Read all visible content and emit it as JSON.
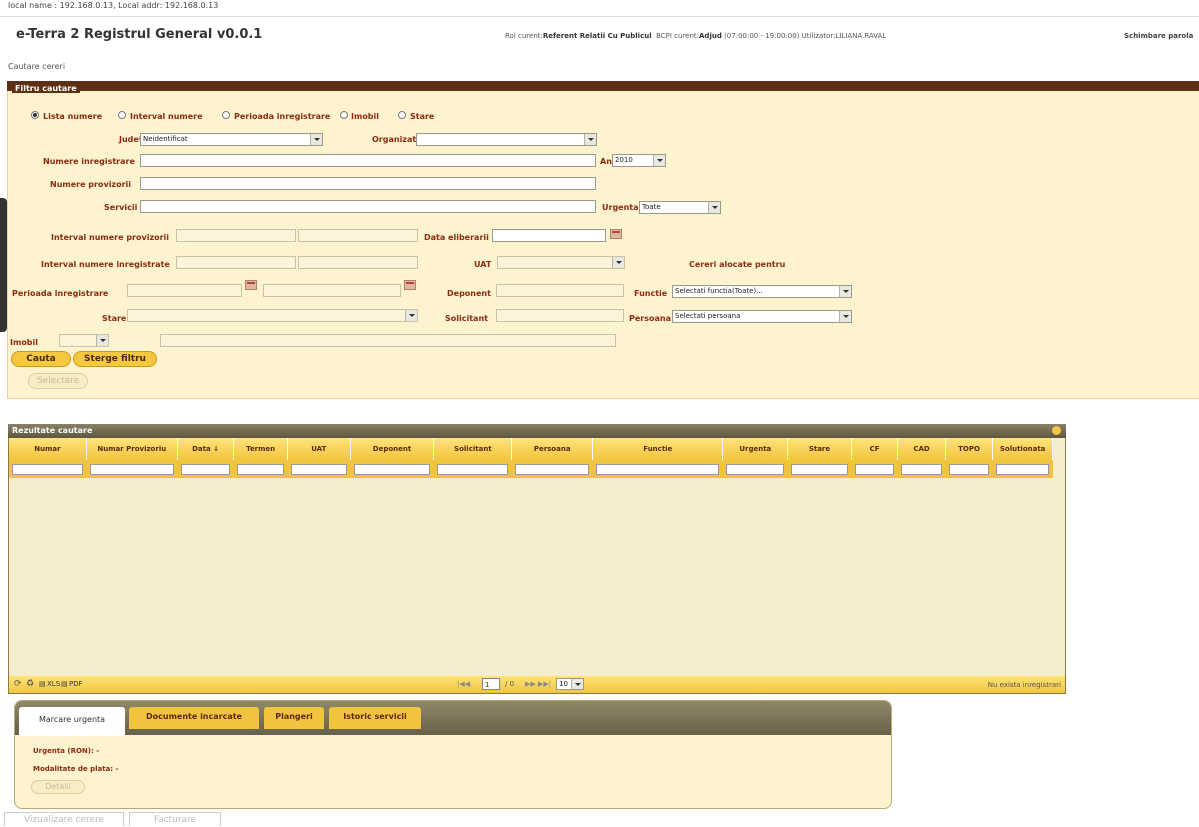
{
  "topbar": {
    "host_info": "local name : 192.168.0.13, Local addr: 192.168.0.13"
  },
  "header": {
    "app_title": "e-Terra 2 Registrul General v0.0.1",
    "rol_label": "Rol curent:",
    "rol_value": "Referent Relatii Cu Publicul",
    "bcpi_label": "BCPI curent:",
    "bcpi_value": "Adjud",
    "bcpi_hours": "(07:00:00 - 19:00:00)",
    "user_label": "Utilizator:",
    "user_value": "LILIANA.RAVAL",
    "change_password": "Schimbare parola"
  },
  "breadcrumb": "Cautare cereri",
  "filter": {
    "legend": "Filtru cautare",
    "radios": [
      {
        "label": "Lista numere",
        "checked": true
      },
      {
        "label": "Interval numere",
        "checked": false
      },
      {
        "label": "Perioada inregistrare",
        "checked": false
      },
      {
        "label": "Imobil",
        "checked": false
      },
      {
        "label": "Stare",
        "checked": false
      }
    ],
    "judet_label": "Judet",
    "judet_value": "Neidentificat",
    "organizatie_label": "Organizatie",
    "organizatie_value": "",
    "numere_inregistrare_label": "Numere inregistrare",
    "an_label": "An",
    "an_value": "2010",
    "numere_provizorii_label": "Numere provizorii",
    "servicii_label": "Servicii",
    "urgenta_label": "Urgenta",
    "urgenta_value": "Toate",
    "interval_provizorii_label": "Interval numere provizorii",
    "data_eliberarii_label": "Data eliberarii",
    "interval_inregistrate_label": "Interval numere inregistrate",
    "uat_label": "UAT",
    "cereri_alocate_label": "Cereri alocate pentru",
    "perioada_label": "Perioada inregistrare",
    "deponent_label": "Deponent",
    "functie_label": "Functie",
    "functie_value": "Selectati functia(Toate)...",
    "stare_label": "Stare",
    "solicitant_label": "Solicitant",
    "persoana_label": "Persoana",
    "persoana_value": "Selectati persoana",
    "imobil_label": "Imobil",
    "cauta_button": "Cauta",
    "sterge_button": "Sterge filtru",
    "selectare_button": "Selectare"
  },
  "results": {
    "title": "Rezultate cautare",
    "columns": [
      "Numar",
      "Numar Provizoriu",
      "Data ↓",
      "Termen",
      "UAT",
      "Deponent",
      "Solicitant",
      "Persoana",
      "Functie",
      "Urgenta",
      "Stare",
      "CF",
      "CAD",
      "TOPO",
      "Solutionata"
    ],
    "export": {
      "xls": "XLS",
      "pdf": "PDF"
    },
    "page_input": "1",
    "page_total": "/ 0",
    "page_size": "10",
    "empty_text": "Nu exista inregistrari"
  },
  "detail_tabs": {
    "tabs": [
      "Marcare urgenta",
      "Documente incarcate",
      "Plangeri",
      "Istoric servicii"
    ],
    "urgenta_ron_label": "Urgenta (RON): -",
    "modalitate_label": "Modalitate de plata: -",
    "detalii_button": "Detalii"
  },
  "bottom_buttons": {
    "vizualizare": "Vizualizare cerere",
    "facturare": "Facturare"
  }
}
